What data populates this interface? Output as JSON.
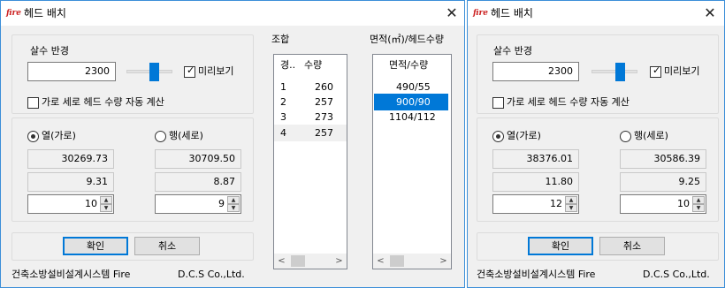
{
  "left": {
    "title": "헤드 배치",
    "icon_text": "fire",
    "close_glyph": "✕",
    "sprinkler_label": "살수 반경",
    "sprinkler_value": "2300",
    "preview_label": "미리보기",
    "preview_checked": true,
    "auto_calc_label": "가로 세로 헤드 수량 자동 계산",
    "auto_calc_checked": false,
    "col_label": "열(가로)",
    "row_label": "행(세로)",
    "col_selected": true,
    "col_values": [
      "30269.73",
      "9.31",
      "10"
    ],
    "row_values": [
      "30709.50",
      "8.87",
      "9"
    ],
    "ok_label": "확인",
    "cancel_label": "취소",
    "footer_left": "건축소방설비설계시스템 Fire",
    "footer_right": "D.C.S Co.,Ltd.",
    "combo_title": "조합",
    "combo_headers": [
      "경..",
      "수량"
    ],
    "combo_rows": [
      [
        "1",
        "260"
      ],
      [
        "2",
        "257"
      ],
      [
        "3",
        "273"
      ],
      [
        "4",
        "257"
      ]
    ],
    "area_title": "면적(㎡)/헤드수량",
    "area_header": "면적/수량",
    "area_rows": [
      "490/55",
      "900/90",
      "1104/112"
    ],
    "scroll_left_glyph": "<",
    "scroll_right_glyph": ">"
  },
  "right": {
    "title": "헤드 배치",
    "icon_text": "fire",
    "close_glyph": "✕",
    "sprinkler_label": "살수 반경",
    "sprinkler_value": "2300",
    "preview_label": "미리보기",
    "preview_checked": true,
    "auto_calc_label": "가로 세로 헤드 수량 자동 계산",
    "auto_calc_checked": false,
    "col_label": "열(가로)",
    "row_label": "행(세로)",
    "col_selected": true,
    "col_values": [
      "38376.01",
      "11.80",
      "12"
    ],
    "row_values": [
      "30586.39",
      "9.25",
      "10"
    ],
    "ok_label": "확인",
    "cancel_label": "취소",
    "footer_left": "건축소방설비설계시스템 Fire",
    "footer_right": "D.C.S Co.,Ltd."
  },
  "colors": {
    "accent": "#0078d7",
    "window_border": "#3c8fd8",
    "background": "#f0f0f0"
  },
  "icons": {
    "close": "close-icon",
    "check": "check-icon",
    "radio": "radio-dot-icon",
    "spin_up": "up-arrow-icon",
    "spin_down": "down-arrow-icon"
  }
}
